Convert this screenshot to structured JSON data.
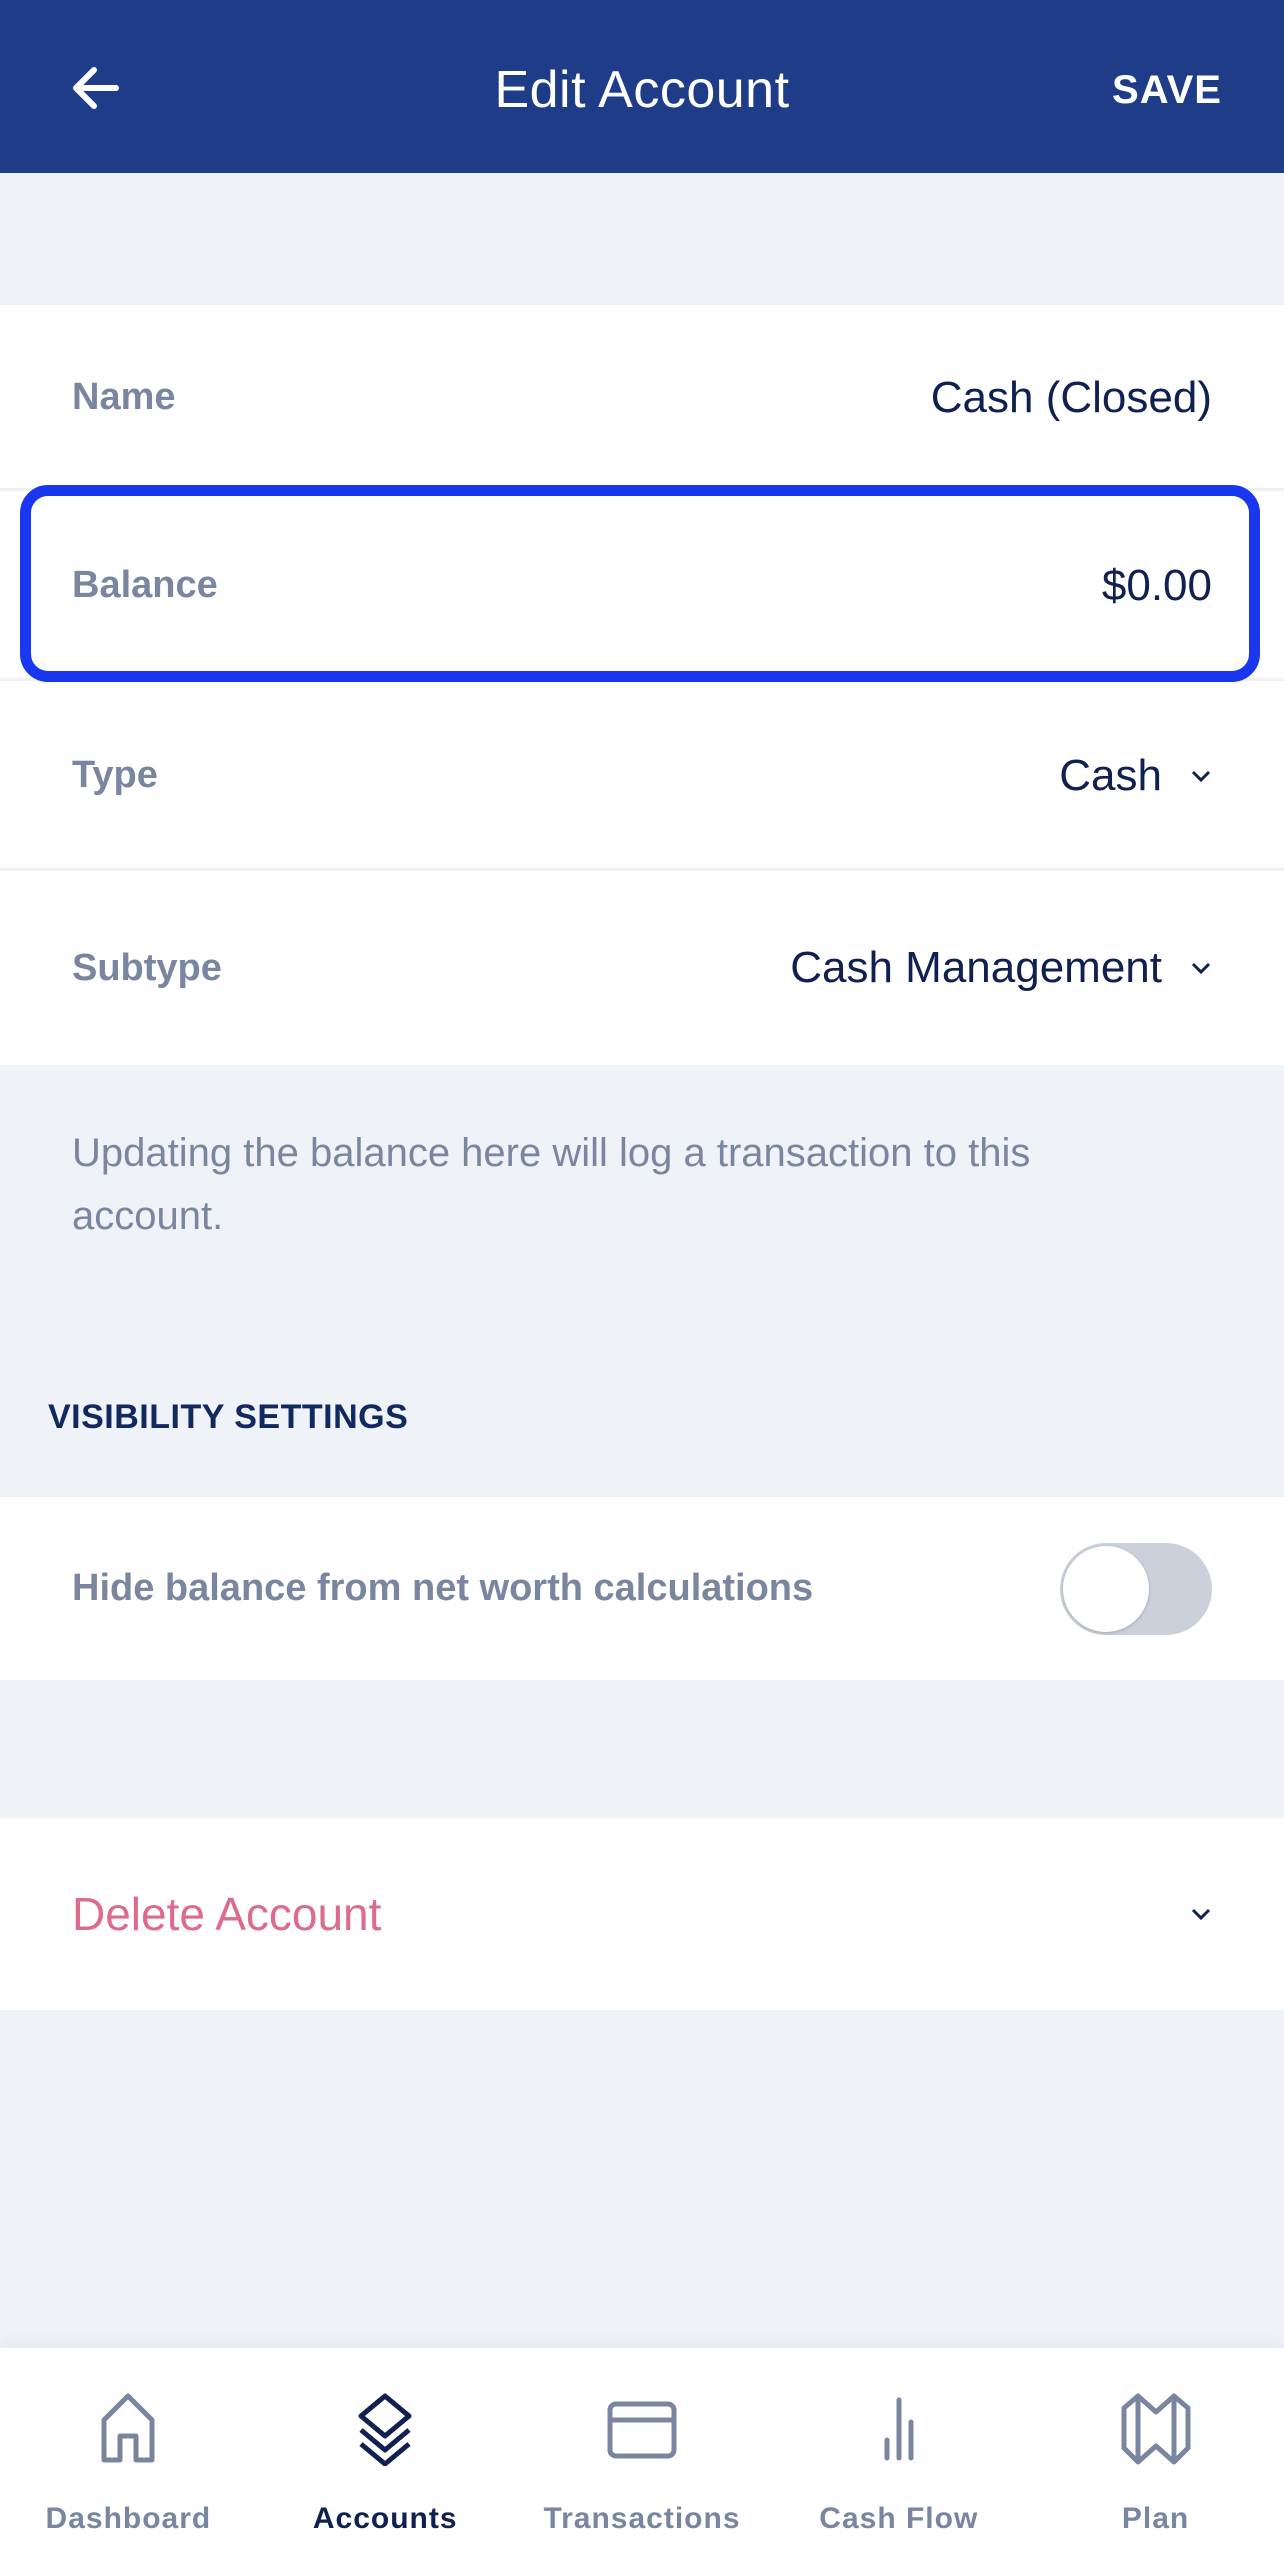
{
  "header": {
    "title": "Edit Account",
    "save_label": "SAVE",
    "back_icon": "arrow-left-icon"
  },
  "fields": [
    {
      "label": "Name",
      "value": "Cash (Closed)"
    },
    {
      "label": "Balance",
      "value": "$0.00"
    },
    {
      "label": "Type",
      "value": "Cash",
      "dropdown": true
    },
    {
      "label": "Subtype",
      "value": "Cash Management",
      "dropdown": true
    }
  ],
  "help_text": "Updating the balance here will log a transaction to this account.",
  "visibility": {
    "heading": "VISIBILITY SETTINGS",
    "toggle_label": "Hide balance from net worth calculations",
    "toggle_on": false
  },
  "delete": {
    "label": "Delete Account"
  },
  "colors": {
    "header": "#1e3c87",
    "delete": "#dd6c8c",
    "highlight": "#1a37f0",
    "active_nav": "#102050",
    "inactive_nav": "#7a86a0"
  },
  "nav": [
    {
      "label": "Dashboard",
      "icon": "home-icon",
      "active": false
    },
    {
      "label": "Accounts",
      "icon": "layers-icon",
      "active": true
    },
    {
      "label": "Transactions",
      "icon": "credit-card-icon",
      "active": false
    },
    {
      "label": "Cash Flow",
      "icon": "bar-chart-icon",
      "active": false
    },
    {
      "label": "Plan",
      "icon": "map-icon",
      "active": false
    }
  ]
}
